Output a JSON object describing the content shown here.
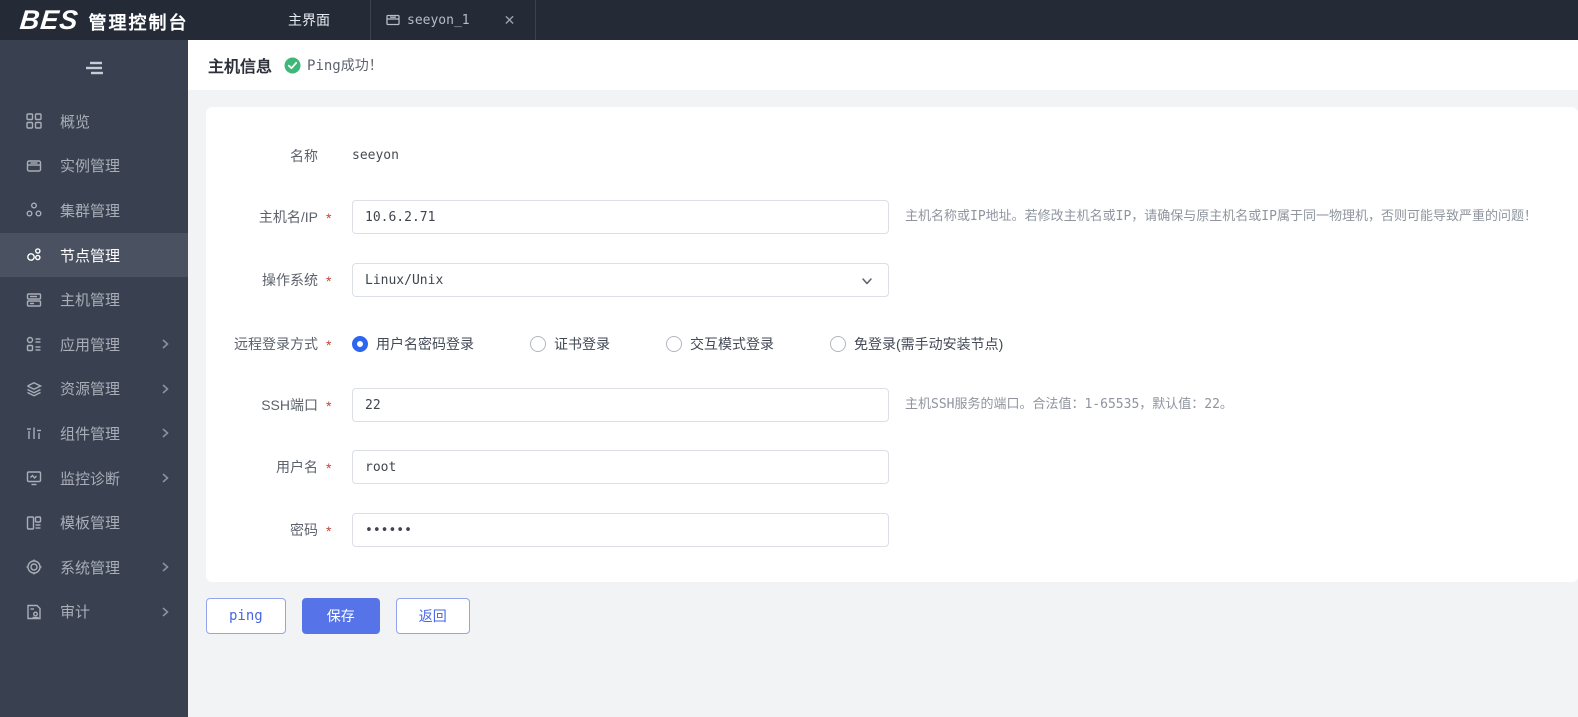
{
  "colors": {
    "topbar_bg": "#252a37",
    "sidebar_bg": "#394150",
    "sidebar_active_bg": "#4a5261",
    "accent_blue": "#5674e8",
    "radio_blue": "#2d66f1",
    "success_green": "#3eb878",
    "required_red": "#bf4537"
  },
  "topbar": {
    "logo_bes": "BES",
    "logo_suffix": "管理控制台",
    "main_tab": "主界面",
    "instance_tab": "seeyon_1",
    "close_glyph": "✕"
  },
  "sidebar": {
    "items": [
      {
        "label": "概览",
        "icon": "overview-icon",
        "active": false,
        "has_children": false
      },
      {
        "label": "实例管理",
        "icon": "instance-icon",
        "active": false,
        "has_children": false
      },
      {
        "label": "集群管理",
        "icon": "cluster-icon",
        "active": false,
        "has_children": false
      },
      {
        "label": "节点管理",
        "icon": "node-icon",
        "active": true,
        "has_children": false
      },
      {
        "label": "主机管理",
        "icon": "host-icon",
        "active": false,
        "has_children": false
      },
      {
        "label": "应用管理",
        "icon": "app-icon",
        "active": false,
        "has_children": true
      },
      {
        "label": "资源管理",
        "icon": "resource-icon",
        "active": false,
        "has_children": true
      },
      {
        "label": "组件管理",
        "icon": "component-icon",
        "active": false,
        "has_children": true
      },
      {
        "label": "监控诊断",
        "icon": "monitor-icon",
        "active": false,
        "has_children": true
      },
      {
        "label": "模板管理",
        "icon": "template-icon",
        "active": false,
        "has_children": false
      },
      {
        "label": "系统管理",
        "icon": "system-icon",
        "active": false,
        "has_children": true
      },
      {
        "label": "审计",
        "icon": "audit-icon",
        "active": false,
        "has_children": true
      }
    ]
  },
  "header": {
    "title": "主机信息",
    "status_text": "Ping成功！"
  },
  "form": {
    "required_mark": "*",
    "name": {
      "label": "名称",
      "value": "seeyon"
    },
    "host": {
      "label": "主机名/IP",
      "value": "10.6.2.71",
      "hint": "主机名称或IP地址。若修改主机名或IP，请确保与原主机名或IP属于同一物理机，否则可能导致严重的问题！"
    },
    "os": {
      "label": "操作系统",
      "value": "Linux/Unix"
    },
    "login_mode": {
      "label": "远程登录方式",
      "options": [
        {
          "label": "用户名密码登录",
          "selected": true
        },
        {
          "label": "证书登录",
          "selected": false
        },
        {
          "label": "交互模式登录",
          "selected": false
        },
        {
          "label": "免登录(需手动安装节点)",
          "selected": false
        }
      ]
    },
    "ssh_port": {
      "label": "SSH端口",
      "value": "22",
      "hint": "主机SSH服务的端口。合法值：1-65535，默认值：22。"
    },
    "username": {
      "label": "用户名",
      "value": "root"
    },
    "password": {
      "label": "密码",
      "value": "••••••"
    }
  },
  "actions": {
    "ping_label": "ping",
    "save_label": "保存",
    "back_label": "返回"
  }
}
